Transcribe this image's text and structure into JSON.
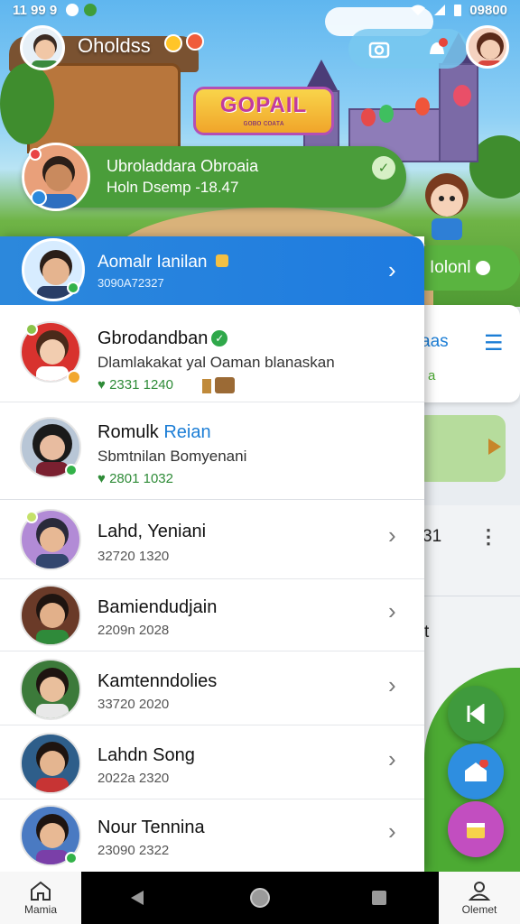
{
  "status_bar": {
    "time": "11 99 9",
    "right_text": "09800"
  },
  "header": {
    "app_title": "Oholdss",
    "logo_main": "GOPAIL",
    "logo_sub": "ɢᴏʙᴏ ᴄᴏᴀᴛᴀ"
  },
  "top_card": {
    "name": "Ubroladdara Obroaia",
    "subtitle": "Holn Dsemp -18.47"
  },
  "drawer_header": {
    "name": "Aomalr Ianilan",
    "subtitle": "3090A72327"
  },
  "contacts": [
    {
      "name": "Gbrodandban",
      "line2": "Dlamlakakat yal Oaman blanaskan",
      "meta": "2331 1240",
      "meta_green": true,
      "verified": true
    },
    {
      "name": "Romulk",
      "name_accent": "Reian",
      "line2": "Sbmtnilan Bomyenani",
      "meta": "2801 1032",
      "meta_green": true
    },
    {
      "name": "Lahd, Yeniani",
      "meta": "32720 1320"
    },
    {
      "name": "Bamiendudjain",
      "meta": "2209n 2028"
    },
    {
      "name": "Kamtenndolies",
      "meta": "33720 2020"
    },
    {
      "name": "Lahdn Song",
      "meta": "2022a 2320"
    },
    {
      "name": "Nour Tennina",
      "meta": "23090 2322"
    }
  ],
  "right_panel": {
    "pill_text": "Iolonl",
    "card_text": "aas",
    "card_text2": "a",
    "list_number": "31",
    "side_letter": "t"
  },
  "bottom_nav": {
    "left_label": "Mamia",
    "right_label": "Olemet"
  },
  "colors": {
    "drawer_blue": "#1e7be0",
    "green": "#4a9d3a",
    "accent": "#1c7ed6"
  },
  "icons": {
    "home": "home-icon",
    "profile": "profile-icon",
    "camera": "camera-icon",
    "chevron": "chevron-right-icon"
  }
}
